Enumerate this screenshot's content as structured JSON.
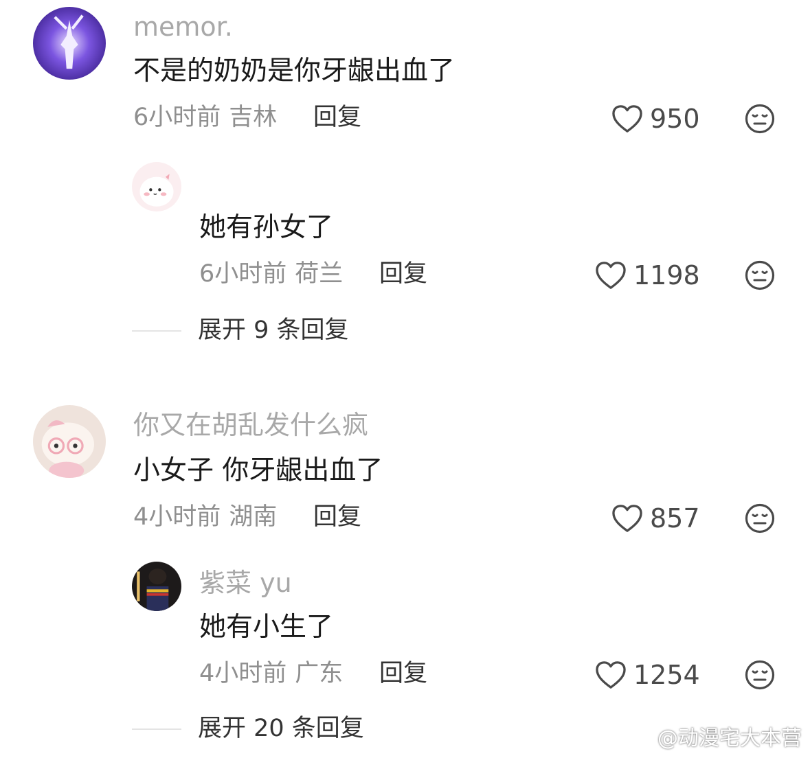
{
  "comments": [
    {
      "username": "memor.",
      "text": "不是的奶奶是你牙龈出血了",
      "time": "6小时前",
      "location": "吉林",
      "reply_label": "回复",
      "likes": "950",
      "replies": [
        {
          "username": "",
          "text": "她有孙女了",
          "time": "6小时前",
          "location": "荷兰",
          "reply_label": "回复",
          "likes": "1198"
        }
      ],
      "expand_label": "展开 9 条回复"
    },
    {
      "username": "你又在胡乱发什么疯",
      "text": "小女子 你牙龈出血了",
      "time": "4小时前",
      "location": "湖南",
      "reply_label": "回复",
      "likes": "857",
      "replies": [
        {
          "username": "紫菜 yu",
          "text": "她有小生了",
          "time": "4小时前",
          "location": "广东",
          "reply_label": "回复",
          "likes": "1254"
        }
      ],
      "expand_label": "展开 20 条回复"
    }
  ],
  "watermark": "@动漫宅大本营",
  "icons": {
    "like": "heart-outline-icon",
    "dislike": "neutral-face-icon",
    "watermark_logo": "weibo-logo-icon"
  },
  "colors": {
    "username": "#a8a8a8",
    "meta": "#8f8f8f",
    "text": "#1a1a1a",
    "avatar1": "#6f4bd8",
    "avatar2": "#f7d6dc",
    "avatar3": "#f0d9d3",
    "avatar4": "#1d1a1a"
  }
}
